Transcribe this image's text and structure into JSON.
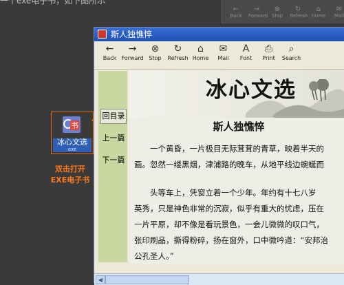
{
  "caption": "一个exe电子书，如下图所示",
  "background_window": {
    "toolbar": [
      "Back",
      "Forward",
      "Stop",
      "Refresh",
      "Home",
      "Mail"
    ]
  },
  "desktop_icon": {
    "glyph": "书",
    "label": "冰心文选",
    "sub_label": "exe"
  },
  "annotation": {
    "line1": "双击打开",
    "line2": "EXE电子书"
  },
  "window": {
    "title": "斯人独憔悴",
    "toolbar": [
      {
        "label": "Back",
        "icon": "←"
      },
      {
        "label": "Forward",
        "icon": "→"
      },
      {
        "label": "Stop",
        "icon": "⊗"
      },
      {
        "label": "Refresh",
        "icon": "↻"
      },
      {
        "label": "Home",
        "icon": "⌂"
      },
      {
        "label": "Mail",
        "icon": "✉"
      },
      {
        "label": "Font",
        "icon": "A"
      },
      {
        "label": "Print",
        "icon": "⎙"
      },
      {
        "label": "Search",
        "icon": "⌕"
      }
    ],
    "nav": [
      "回目录",
      "上一篇",
      "下一篇"
    ],
    "banner_title": "冰心文选",
    "article_title": "斯人独憔悴",
    "paragraphs": [
      "　　一个黄昏，一片极目无际茸茸的青草，映着半天的\n画。忽然一缕黑烟，津浦路的晚车，从地平线边蜿蜒而",
      "　　头等车上，凭窗立着一个少年。年约有十七八岁\n英秀，只是神色非常的沉寂，似乎有重大的忧虑，压在\n一片平原，却不像是看玩景色，一会儿微微的叹口气，\n张印刷品，撕得粉碎，扬在窗外，口中微吟道：“安邦治\n公孔圣人。”"
    ]
  }
}
